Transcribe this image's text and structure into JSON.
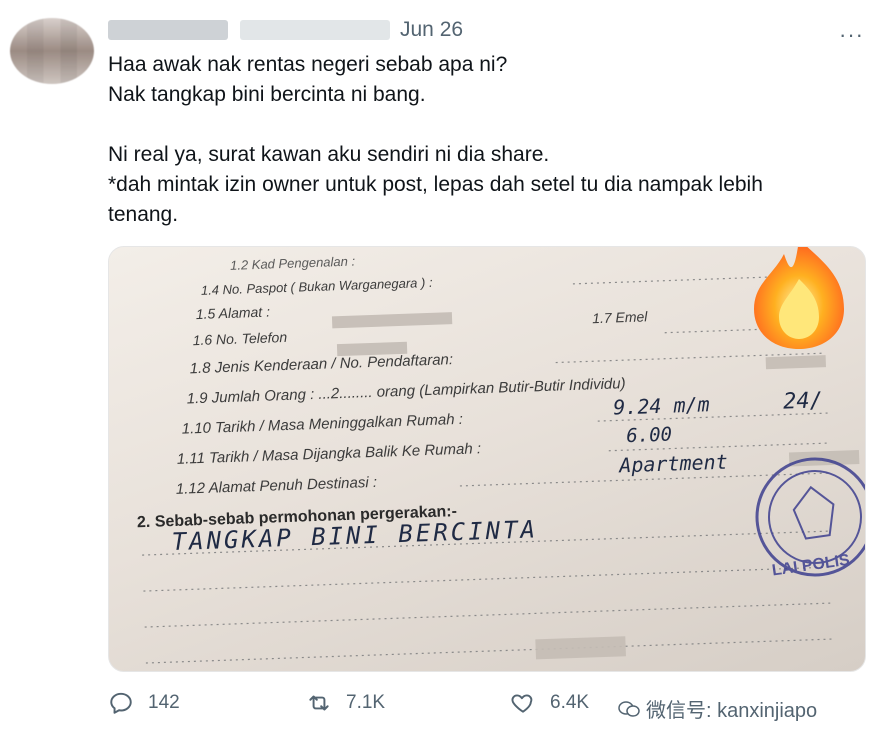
{
  "header": {
    "date": "Jun 26",
    "more": "···"
  },
  "tweet": {
    "lines_1": [
      "Haa awak nak rentas negeri sebab apa ni?",
      "Nak tangkap bini bercinta ni bang."
    ],
    "lines_2": [
      "Ni real ya, surat kawan aku sendiri ni dia share.",
      "*dah mintak izin owner untuk post, lepas dah setel tu dia nampak lebih",
      "tenang."
    ]
  },
  "photo": {
    "form_lines": [
      "1.2 Kad Pengenalan :",
      "1.4 No. Paspot ( Bukan Warganegara ) :",
      "1.5 Alamat :",
      "1.6 No. Telefon",
      "1.7   Emel",
      "1.8 Jenis Kenderaan / No. Pendaftaran:",
      "1.9 Jumlah Orang : ...2........ orang (Lampirkan Butir-Butir Individu)",
      "1.10 Tarikh / Masa Meninggalkan Rumah :",
      "1.11 Tarikh / Masa Dijangka Balik Ke Rumah :",
      "1.12 Alamat Penuh Destinasi :",
      "2.  Sebab-sebab permohonan pergerakan:-"
    ],
    "handwriting": {
      "time_out": "9.24  m/m",
      "time_back": "6.00",
      "dest": "Apartment",
      "reason": "TANGKAP   BINI   BERCINTA",
      "date_partial": "24/"
    },
    "stamp_text": "LAI POLIS"
  },
  "actions": {
    "reply_count": "142",
    "retweet_count": "7.1K",
    "like_count": "6.4K"
  },
  "watermark": {
    "text": "微信号: kanxinjiapo"
  }
}
